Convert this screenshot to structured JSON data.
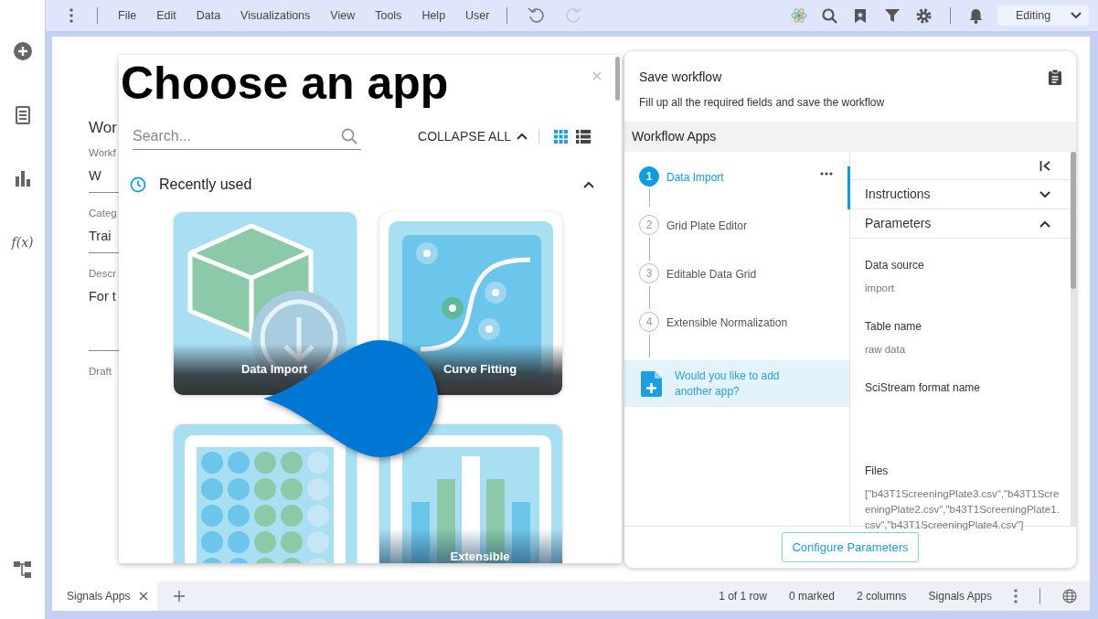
{
  "menu_bar": {
    "items": [
      "File",
      "Edit",
      "Data",
      "Visualizations",
      "View",
      "Tools",
      "Help",
      "User"
    ],
    "history": [
      {
        "kind": "undo",
        "disabled": false
      },
      {
        "kind": "redo",
        "disabled": true
      }
    ],
    "mode": "Editing"
  },
  "sidebar": {
    "formula_label": "f(x)"
  },
  "background_form": {
    "title": "Wor",
    "fields": [
      {
        "label": "Workf",
        "value": "W"
      },
      {
        "label": "Categ",
        "value": "Trai"
      },
      {
        "label": "Descr",
        "value": "For t"
      }
    ],
    "status": "Draft"
  },
  "app_chooser": {
    "title": "Choose an app",
    "search": {
      "placeholder": "Search..."
    },
    "collapse_all": "COLLAPSE ALL",
    "view_modes": [
      {
        "kind": "grid",
        "selected": true
      },
      {
        "kind": "list",
        "selected": false
      }
    ],
    "section": {
      "title": "Recently used",
      "expanded": true
    },
    "apps": [
      {
        "kind": "import",
        "name": "Data Import"
      },
      {
        "kind": "curve",
        "name": "Curve Fitting"
      },
      {
        "kind": "plate"
      },
      {
        "kind": "bars",
        "name": "Extensible"
      }
    ]
  },
  "workflow": {
    "title": "Save workflow",
    "subtitle": "Fill up all the required fields and save the workflow",
    "apps_heading": "Workflow Apps",
    "steps": [
      {
        "number": "1",
        "name": "Data Import",
        "selected": true
      },
      {
        "number": "2",
        "name": "Grid Plate Editor",
        "selected": false
      },
      {
        "number": "3",
        "name": "Editable Data Grid",
        "selected": false
      },
      {
        "number": "4",
        "name": "Extensible Normalization",
        "selected": false
      }
    ],
    "add_app": "Would you like to add another app?",
    "sections": [
      {
        "title": "Instructions",
        "expanded": false
      },
      {
        "title": "Parameters",
        "expanded": true
      }
    ],
    "parameters": [
      {
        "label": "Data source",
        "value": "import"
      },
      {
        "label": "Table name",
        "value": "raw data"
      },
      {
        "label": "SciStream format name"
      },
      {
        "label": "Files",
        "value": "[\"b43T1ScreeningPlate3.csv\",\"b43T1ScreeningPlate2.csv\",\"b43T1ScreeningPlate1.csv\",\"b43T1ScreeningPlate4.csv\"]"
      }
    ],
    "button": "Configure Parameters"
  },
  "bottom_bar": {
    "tabs": [
      {
        "label": "Signals Apps",
        "selected": true
      }
    ],
    "status": [
      "1 of 1 row",
      "0 marked",
      "2 columns",
      "Signals Apps"
    ]
  }
}
